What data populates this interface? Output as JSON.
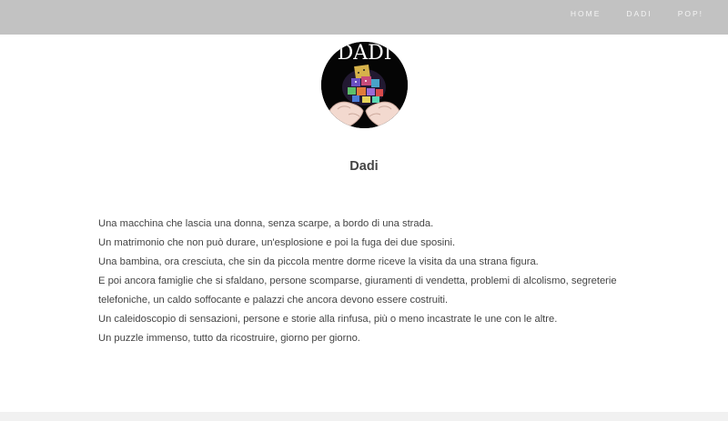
{
  "nav": {
    "items": [
      {
        "label": "HOME"
      },
      {
        "label": "DADI"
      },
      {
        "label": "POP!"
      }
    ]
  },
  "logo": {
    "text": "DADI",
    "icon": "hands-holding-dice-icon"
  },
  "page_title": "Dadi",
  "paragraphs": [
    "Una macchina che lascia una donna, senza scarpe, a bordo di una strada.",
    "Un matrimonio che non può durare, un'esplosione e poi la fuga dei due sposini.",
    "Una bambina, ora cresciuta, che sin da piccola mentre dorme riceve la visita da una strana figura.",
    "E poi ancora famiglie che si sfaldano, persone scomparse, giuramenti di vendetta, problemi di alcolismo, segreterie telefoniche, un caldo soffocante e palazzi che ancora devono essere costruiti.",
    "Un caleidoscopio di sensazioni, persone e storie alla rinfusa, più o meno incastrate le une con le altre.",
    "Un puzzle immenso, tutto da ricostruire, giorno per giorno."
  ],
  "colors": {
    "topbar": "#c2c2c2",
    "nav_text": "#f4f4f4",
    "body_text": "#444444"
  }
}
